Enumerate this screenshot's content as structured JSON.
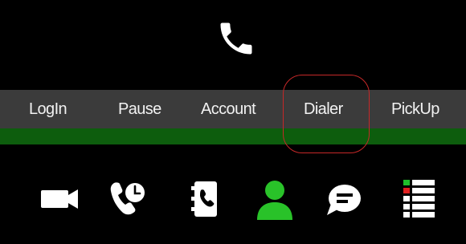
{
  "header": {
    "logo_icon": "phone-icon"
  },
  "menu": {
    "items": [
      {
        "label": "LogIn"
      },
      {
        "label": "Pause"
      },
      {
        "label": "Account"
      },
      {
        "label": "Dialer"
      },
      {
        "label": "PickUp"
      }
    ],
    "highlighted": "Dialer"
  },
  "toolbar": {
    "icons": [
      "video-camera-icon",
      "call-history-icon",
      "phonebook-icon",
      "user-icon",
      "chat-icon",
      "list-icon"
    ]
  },
  "colors": {
    "background": "#000000",
    "menu_bar": "#3b3b3b",
    "accent_bar": "#0d5d0d",
    "user_icon": "#29c229",
    "highlight": "#c62828",
    "list_red": "#e02020",
    "list_green": "#1fbf2b"
  }
}
